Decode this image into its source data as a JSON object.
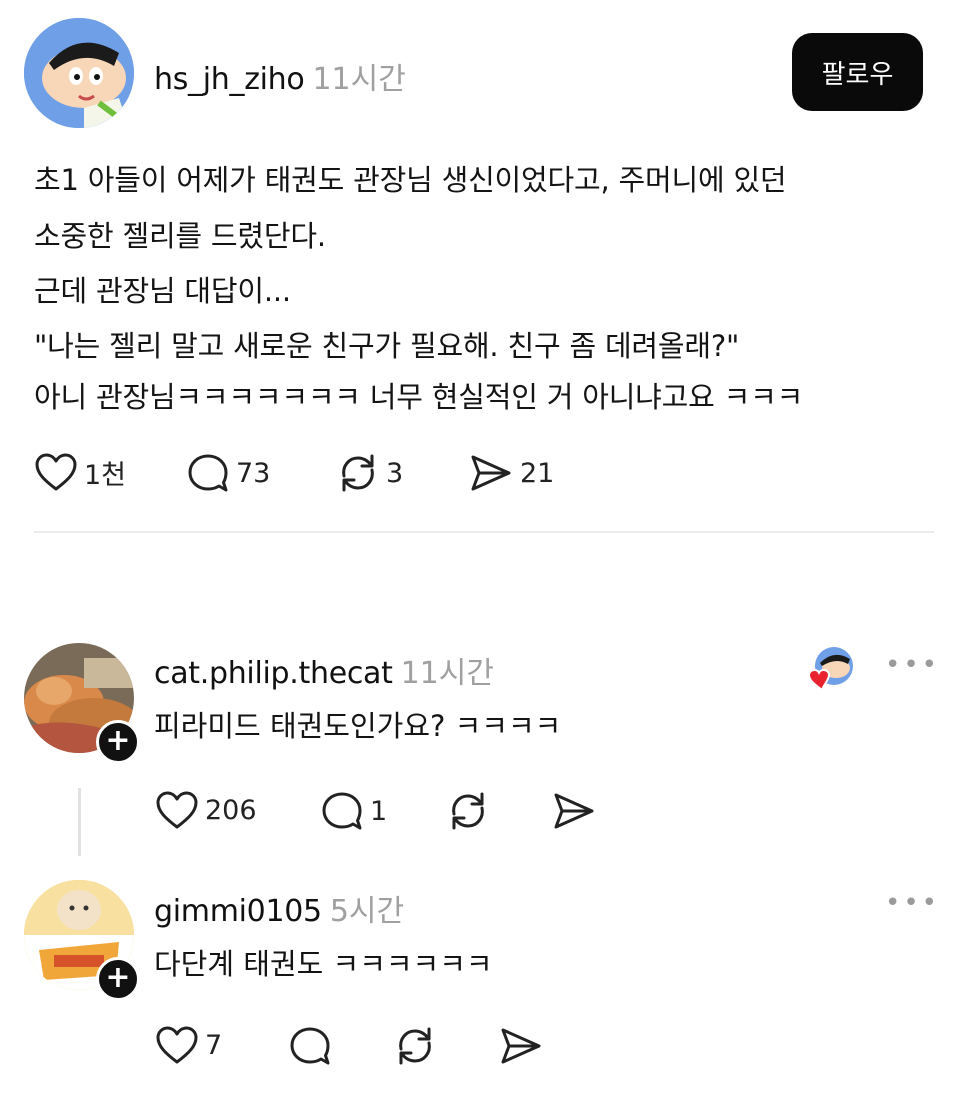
{
  "post": {
    "username": "hs_jh_ziho",
    "time": "11시간",
    "follow_label": "팔로우",
    "lines": [
      "초1 아들이 어제가 태권도 관장님 생신이었다고, 주머니에 있던",
      "소중한 젤리를 드렸단다.",
      "근데 관장님 대답이...",
      "\"나는 젤리 말고 새로운 친구가 필요해. 친구 좀 데려올래?\"",
      "아니 관장님ㅋㅋㅋㅋㅋㅋㅋ 너무 현실적인 거 아니냐고요 ㅋㅋㅋ"
    ],
    "likes": "1천",
    "comments": "73",
    "reposts": "3",
    "shares": "21"
  },
  "comments": [
    {
      "username": "cat.philip.thecat",
      "time": "11시간",
      "text": "피라미드 태권도인가요? ㅋㅋㅋㅋ",
      "likes": "206",
      "replies": "1",
      "more": "•••"
    },
    {
      "username": "gimmi0105",
      "time": "5시간",
      "text": "다단계 태권도 ㅋㅋㅋㅋㅋㅋ",
      "likes": "7",
      "more": "•••"
    }
  ],
  "icons": {
    "like": "heart-icon",
    "comment": "comment-bubble-icon",
    "repost": "repost-icon",
    "share": "send-icon",
    "more": "more-icon",
    "follow_badge": "plus-icon"
  },
  "colors": {
    "button_bg": "#0a0a0a",
    "muted_text": "#a0a0a0",
    "liked_heart": "#e8232f"
  }
}
